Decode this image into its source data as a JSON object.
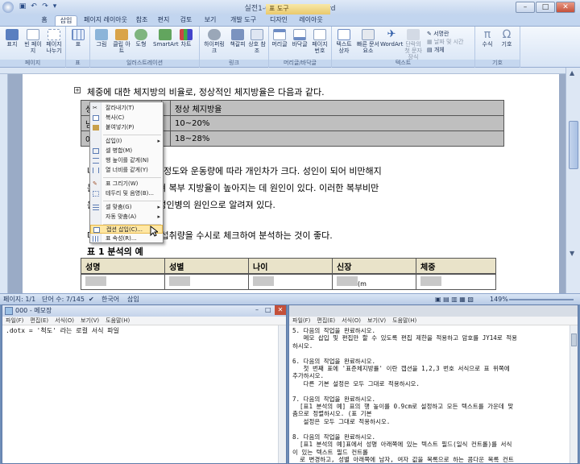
{
  "word": {
    "title": "실전1-06 - Microsoft Word",
    "context_tab_header": "표 도구",
    "tabs": [
      "홈",
      "삽입",
      "페이지 레이아웃",
      "참조",
      "편지",
      "검토",
      "보기",
      "개발 도구",
      "디자인",
      "레이아웃"
    ],
    "active_tab": "삽입",
    "ribbon_groups": [
      {
        "label": "페이지",
        "buttons": [
          "표지",
          "빈 페이지",
          "페이지 나누기"
        ]
      },
      {
        "label": "표",
        "buttons": [
          "표"
        ]
      },
      {
        "label": "일러스트레이션",
        "buttons": [
          "그림",
          "클립 아트",
          "도형",
          "SmartArt",
          "차트"
        ]
      },
      {
        "label": "링크",
        "buttons": [
          "하이퍼링크",
          "책갈피",
          "상호 참조"
        ]
      },
      {
        "label": "머리글/바닥글",
        "buttons": [
          "머리글",
          "바닥글",
          "페이지 번호"
        ]
      },
      {
        "label": "텍스트",
        "buttons": [
          "텍스트 상자",
          "빠른 문서 요소",
          "WordArt",
          "단락의 첫 문자 장식"
        ]
      },
      {
        "label": "텍스트",
        "small_buttons": [
          "서명란",
          "날짜 및 시간",
          "개체"
        ]
      },
      {
        "label": "기호",
        "buttons": [
          "수식",
          "기호"
        ]
      }
    ],
    "document": {
      "line1": "체중에 대한 체지방의 비율로, 정상적인 체지방율은 다음과 같다.",
      "table1": [
        [
          "성",
          "",
          "정상 체지방율"
        ],
        [
          "남",
          "",
          "10~20%"
        ],
        [
          "여",
          "",
          "18~28%"
        ]
      ],
      "para2a": "나                 방의 비율은 비만 정도와 운동량에 따라 개인차가 크다. 성인이 되어 비만해지",
      "para2b": "는                 장지방이 과다해져 복부 지방율이 높아지는 데 원인이 있다. 이러한 복부비만",
      "para2c": "은                 질환, 당뇨병 등 성인병의 원인으로 알려져 있다.",
      "para3": "다                 본인의 체지방과 섭취량을 수시로 체크하여 분석하는 것이 좋다.",
      "caption": "표 1 분석의 예",
      "table2_headers": [
        "성명",
        "성별",
        "나이",
        "신장",
        "체중"
      ],
      "table2_row_extra": "(m"
    },
    "context_menu": [
      {
        "label": "잘라내기(T)",
        "icon": "scissors-icon"
      },
      {
        "label": "복사(C)",
        "icon": "copy-icon"
      },
      {
        "label": "붙여넣기(P)",
        "icon": "paste-icon"
      },
      {
        "sep": true
      },
      {
        "label": "삽입(I)",
        "submenu": true
      },
      {
        "label": "셀 병합(M)",
        "icon": "merge-icon"
      },
      {
        "label": "행 높이를 같게(N)",
        "icon": "row-height-icon"
      },
      {
        "label": "열 너비를 같게(Y)",
        "icon": "col-width-icon"
      },
      {
        "sep": true
      },
      {
        "label": "표 그리기(W)",
        "icon": "pencil-icon"
      },
      {
        "label": "테두리 및 음영(B)...",
        "icon": "border-icon"
      },
      {
        "sep": true
      },
      {
        "label": "셀 맞춤(G)",
        "icon": "align-icon",
        "submenu": true
      },
      {
        "label": "자동 맞춤(A)",
        "submenu": true
      },
      {
        "sep": true
      },
      {
        "label": "캡션 삽입(C)...",
        "icon": "caption-icon",
        "highlighted": true
      },
      {
        "label": "표 속성(R)...",
        "icon": "table-props-icon"
      }
    ],
    "status": {
      "page": "페이지: 1/1",
      "words": "단어 수: 7/145",
      "lang": "한국어",
      "mode": "삽입",
      "zoom": "149%"
    }
  },
  "notepad_left": {
    "title": "000 - 메모장",
    "menu": [
      "파일(F)",
      "편집(E)",
      "서식(O)",
      "보기(V)",
      "도움말(H)"
    ],
    "content": ".dotx = '척도' 라는 로컬 서식 파일"
  },
  "notepad_right": {
    "menu": [
      "파일(F)",
      "편집(E)",
      "서식(O)",
      "보기(V)",
      "도움말(H)"
    ],
    "lines": [
      "5. 다음의 작업을 완료하시오.",
      "   메모 삽입 및 편집만 할 수 있도록 편집 제한을 적용하고 암호를 JY14로 적용",
      "하시오.",
      "",
      "6. 다음의 작업을 완료하시오.",
      "   첫 번째 표에 '표준체지방률' 이란 캡션을 1,2,3 번호 서식으로 표 위쪽에",
      "추가하시오.",
      "   다른 기본 설정은 모두 그대로 적용하시오.",
      "",
      "7. 다음의 작업을 완료하시오.",
      "  [표1 분석의 예] 표의 행 높이를 0.9cm로 설정하고 모든 텍스트를 가운데 맞",
      "춤으로 정렬하시오. (표 기본",
      "   설정은 모두 그대로 적용하시오.",
      "",
      "8. 다음의 작업을 완료하시오.",
      "  [표1 분석의 예]표에서 성명 아래쪽에 있는 텍스트 필드(일식 컨트롤)를 서식",
      "이 있는 텍스트 필드 컨트롤",
      "  로 변경하고, 성별 아래쪽에 남자, 여자 값을 목록으로 하는 콤다운 목록 컨트"
    ]
  }
}
